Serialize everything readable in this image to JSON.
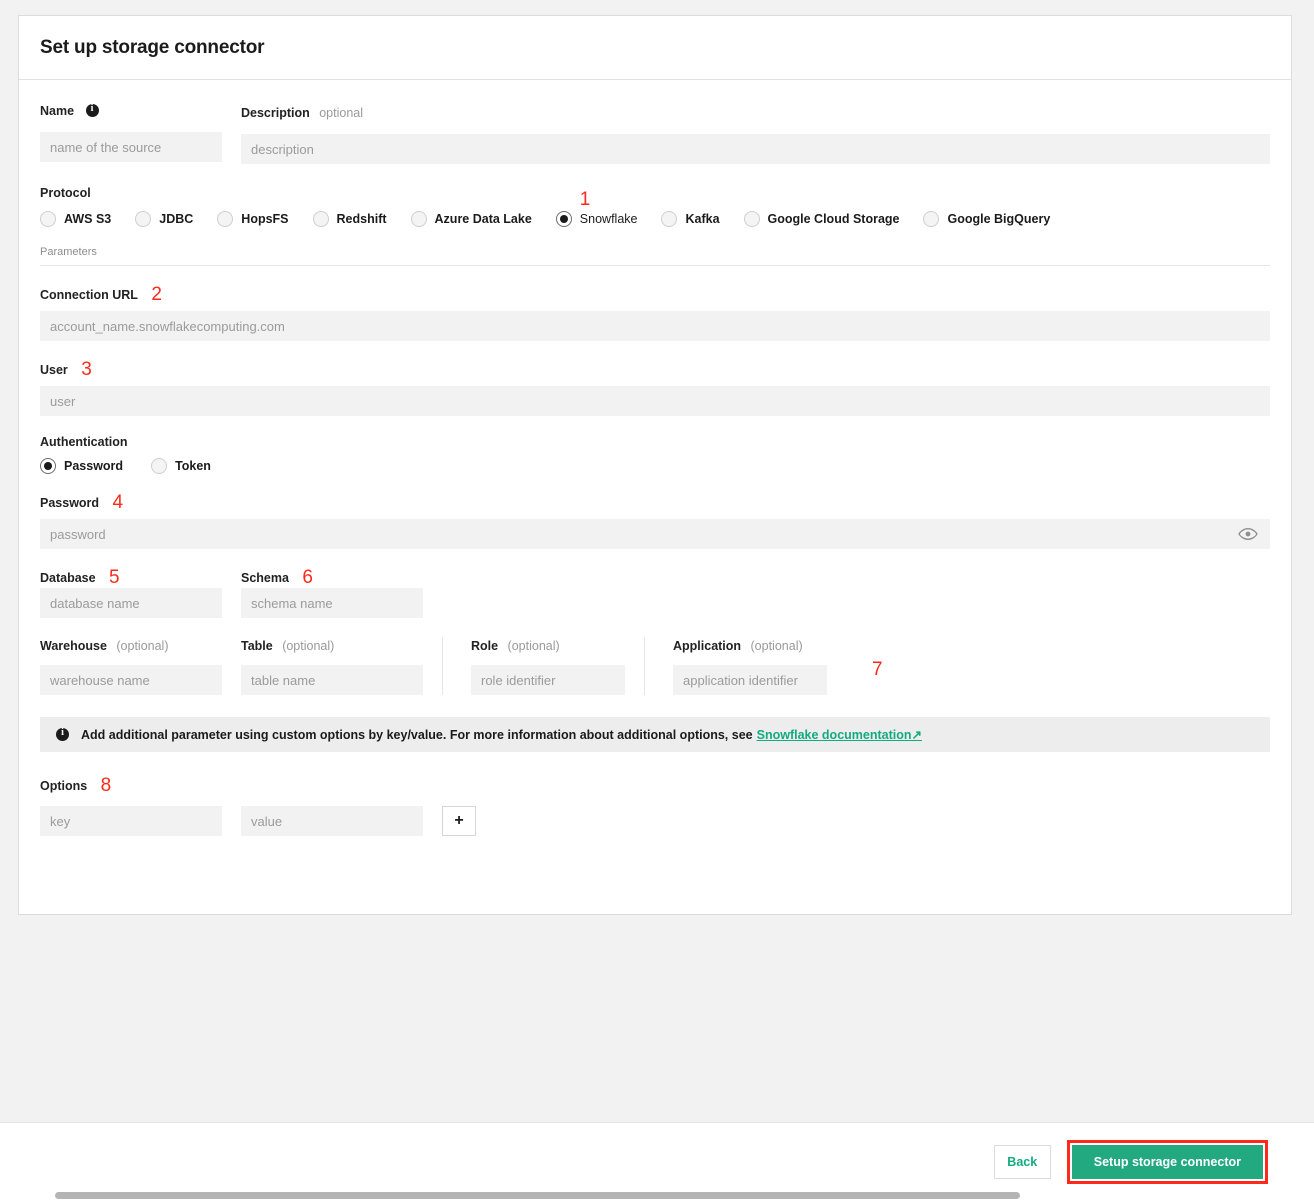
{
  "card": {
    "title": "Set up storage connector"
  },
  "name_field": {
    "label": "Name",
    "info_icon": "info-icon",
    "placeholder": "name of the source",
    "value": ""
  },
  "description_field": {
    "label": "Description",
    "optional": "optional",
    "placeholder": "description",
    "value": ""
  },
  "protocol": {
    "label": "Protocol",
    "selected": "Snowflake",
    "marker": "1",
    "options": [
      {
        "label": "AWS S3",
        "checked": false
      },
      {
        "label": "JDBC",
        "checked": false
      },
      {
        "label": "HopsFS",
        "checked": false
      },
      {
        "label": "Redshift",
        "checked": false
      },
      {
        "label": "Azure Data Lake",
        "checked": false
      },
      {
        "label": "Snowflake",
        "checked": true
      },
      {
        "label": "Kafka",
        "checked": false
      },
      {
        "label": "Google Cloud Storage",
        "checked": false
      },
      {
        "label": "Google BigQuery",
        "checked": false
      }
    ]
  },
  "parameters_caption": "Parameters",
  "connection_url": {
    "label": "Connection URL",
    "marker": "2",
    "placeholder": "account_name.snowflakecomputing.com",
    "value": ""
  },
  "user": {
    "label": "User",
    "marker": "3",
    "placeholder": "user",
    "value": ""
  },
  "authentication": {
    "label": "Authentication",
    "selected": "Password",
    "options": [
      {
        "label": "Password",
        "checked": true
      },
      {
        "label": "Token",
        "checked": false
      }
    ]
  },
  "password": {
    "label": "Password",
    "marker": "4",
    "placeholder": "password",
    "value": "",
    "reveal_icon": "eye-icon"
  },
  "database": {
    "label": "Database",
    "marker": "5",
    "placeholder": "database name",
    "value": ""
  },
  "schema": {
    "label": "Schema",
    "marker": "6",
    "placeholder": "schema name",
    "value": ""
  },
  "warehouse": {
    "label": "Warehouse",
    "optional": "(optional)",
    "placeholder": "warehouse name",
    "value": ""
  },
  "table": {
    "label": "Table",
    "optional": "(optional)",
    "placeholder": "table name",
    "value": ""
  },
  "role": {
    "label": "Role",
    "optional": "(optional)",
    "placeholder": "role identifier",
    "value": ""
  },
  "application": {
    "label": "Application",
    "optional": "(optional)",
    "placeholder": "application identifier",
    "value": "",
    "marker": "7"
  },
  "banner": {
    "icon": "info-icon",
    "text": "Add additional parameter using custom options by key/value. For more information about additional options, see",
    "link_text": "Snowflake documentation↗"
  },
  "options": {
    "label": "Options",
    "marker": "8",
    "key_placeholder": "key",
    "key_value": "",
    "value_placeholder": "value",
    "value_value": "",
    "add_label": "+"
  },
  "footer": {
    "back_label": "Back",
    "submit_label": "Setup storage connector"
  },
  "colors": {
    "accent_green": "#23a97f",
    "link_green": "#12ab7f",
    "highlight_red": "#fc2a1b",
    "field_bg": "#f2f2f2",
    "page_bg": "#f2f2f2"
  }
}
